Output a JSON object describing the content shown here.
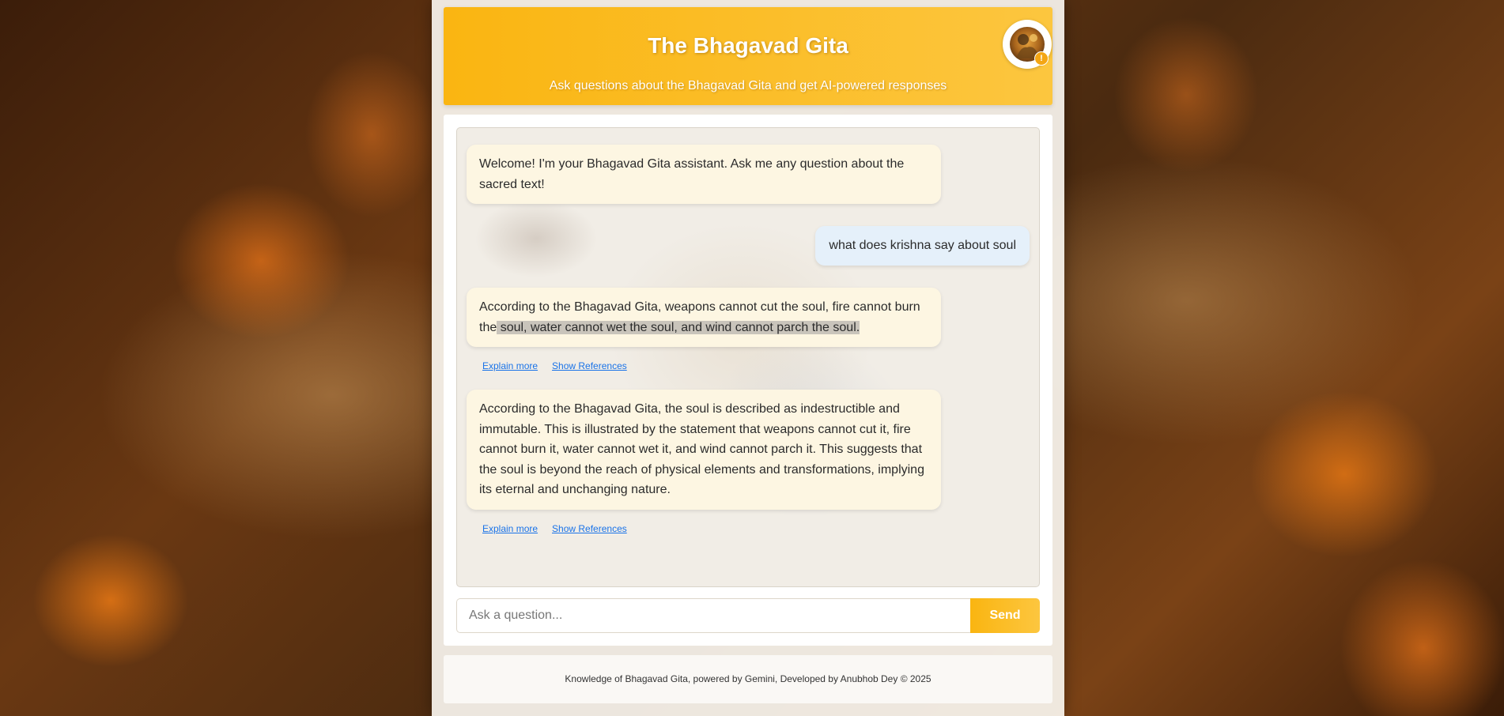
{
  "header": {
    "title": "The Bhagavad Gita",
    "subtitle": "Ask questions about the Bhagavad Gita and get AI-powered responses",
    "avatar_icon": "krishna-portrait-icon",
    "badge_glyph": "!"
  },
  "messages": [
    {
      "role": "bot",
      "text": "Welcome! I'm your Bhagavad Gita assistant. Ask me any question about the sacred text!"
    },
    {
      "role": "user",
      "text": "what does krishna say about soul"
    },
    {
      "role": "bot",
      "text_plain": "According to the Bhagavad Gita, weapons cannot cut the soul, fire cannot burn the",
      "text_highlighted": " soul, water cannot wet the soul, and wind cannot parch the soul.",
      "actions": [
        "Explain more",
        "Show References"
      ]
    },
    {
      "role": "bot",
      "text": "According to the Bhagavad Gita, the soul is described as indestructible and immutable. This is illustrated by the statement that weapons cannot cut it, fire cannot burn it, water cannot wet it, and wind cannot parch it. This suggests that the soul is beyond the reach of physical elements and transformations, implying its eternal and unchanging nature.",
      "actions": [
        "Explain more",
        "Show References"
      ]
    }
  ],
  "input": {
    "placeholder": "Ask a question...",
    "value": "",
    "send_label": "Send"
  },
  "footer": {
    "text": "Knowledge of Bhagavad Gita, powered by Gemini, Developed by Anubhob Dey © 2025"
  },
  "colors": {
    "accent": "#fab511",
    "bot_bubble": "#fdf6e2",
    "user_bubble": "#e5f0fa",
    "link": "#1a73e8"
  }
}
